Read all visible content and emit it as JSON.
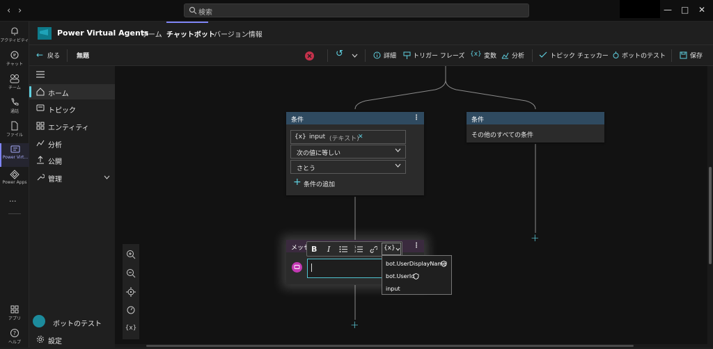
{
  "search": {
    "placeholder": "検索"
  },
  "rail": {
    "items": [
      {
        "label": "アクティビティ",
        "icon": "bell-icon"
      },
      {
        "label": "チャット",
        "icon": "chat-icon"
      },
      {
        "label": "チーム",
        "icon": "teams-icon"
      },
      {
        "label": "通話",
        "icon": "phone-icon"
      },
      {
        "label": "ファイル",
        "icon": "file-icon"
      },
      {
        "label": "Power Virt...",
        "icon": "power-virtual-agents-icon"
      },
      {
        "label": "Power Apps",
        "icon": "power-apps-icon"
      },
      {
        "label": "アプリ",
        "icon": "apps-icon"
      },
      {
        "label": "ヘルプ",
        "icon": "help-icon"
      }
    ]
  },
  "app": {
    "title": "Power Virtual Agents",
    "tabs": [
      "ホーム",
      "チャットボット",
      "バージョン情報"
    ],
    "active_tab": "チャットボット"
  },
  "toolbar": {
    "back": "戻る",
    "topic_name": "無題",
    "details": "詳細",
    "trigger_phrases": "トリガー フレーズ",
    "variables": "変数",
    "analytics": "分析",
    "topic_checker": "トピック チェッカー",
    "test_bot": "ボットのテスト",
    "save": "保存"
  },
  "sidebar": {
    "items": [
      {
        "label": "ホーム",
        "icon": "home-icon"
      },
      {
        "label": "トピック",
        "icon": "topic-icon"
      },
      {
        "label": "エンティティ",
        "icon": "entity-icon"
      },
      {
        "label": "分析",
        "icon": "analytics-icon"
      },
      {
        "label": "公開",
        "icon": "publish-icon"
      },
      {
        "label": "管理",
        "icon": "manage-icon"
      }
    ],
    "test_bot": "ボットのテスト",
    "settings": "設定"
  },
  "canvas": {
    "condition1": {
      "title": "条件",
      "var_token": "{x}",
      "var_name": "input",
      "var_type": "(テキスト)",
      "operator": "次の値に等しい",
      "value": "さとう",
      "add_condition": "条件の追加"
    },
    "condition2": {
      "title": "条件",
      "text": "その他のすべての条件"
    },
    "message": {
      "title": "メッセ",
      "variable_options": [
        "bot.UserDisplayName",
        "bot.UserId",
        "input"
      ],
      "var_button": "{x}"
    },
    "zoom": {
      "var_label": "{x}"
    }
  },
  "colors": {
    "accent": "#7f85f5",
    "teal": "#5fd0e0",
    "header": "#2f4a60",
    "stop": "#c4314b"
  }
}
